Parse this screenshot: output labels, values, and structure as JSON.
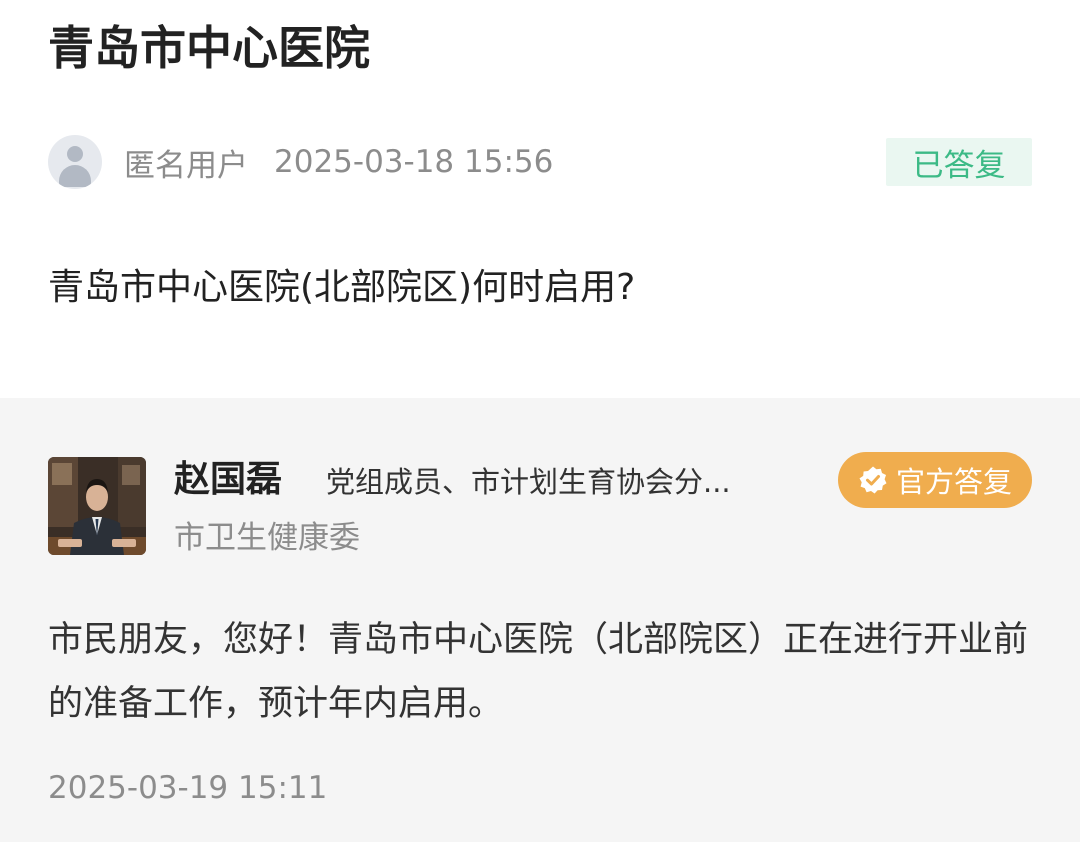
{
  "question": {
    "title": "青岛市中心医院",
    "asker_name": "匿名用户",
    "asked_at": "2025-03-18 15:56",
    "status": "已答复",
    "text": "青岛市中心医院(北部院区)何时启用?"
  },
  "reply": {
    "official_name": "赵国磊",
    "official_position": "党组成员、市计划生育协会分...",
    "department": "市卫生健康委",
    "badge_label": "官方答复",
    "text": "市民朋友，您好！青岛市中心医院（北部院区）正在进行开业前的准备工作，预计年内启用。",
    "replied_at": "2025-03-19 15:11"
  },
  "icons": {
    "anonymous_avatar": "user-silhouette-icon",
    "official_badge": "verified-check-icon"
  },
  "colors": {
    "status_text": "#3cba86",
    "status_bg": "#eaf7f1",
    "official_badge_bg": "#f0ad4e",
    "answer_bg": "#f5f5f5"
  }
}
